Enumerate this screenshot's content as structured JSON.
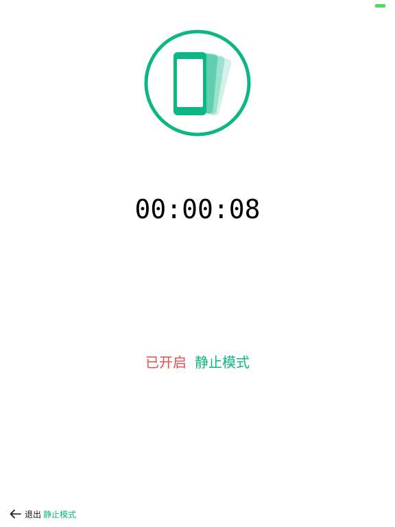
{
  "status_bar": {
    "battery_color": "#4cd964"
  },
  "hero": {
    "icon": "phone-shake-icon",
    "accent_color": "#0cb685"
  },
  "timer": {
    "display": "00:00:08"
  },
  "status": {
    "enabled_text": "已开启",
    "enabled_color": "#e94b4b",
    "mode_text": "静止模式",
    "mode_color": "#0cb685"
  },
  "footer": {
    "back_icon": "arrow-left-icon",
    "exit_label": "退出",
    "exit_mode": "静止模式"
  }
}
